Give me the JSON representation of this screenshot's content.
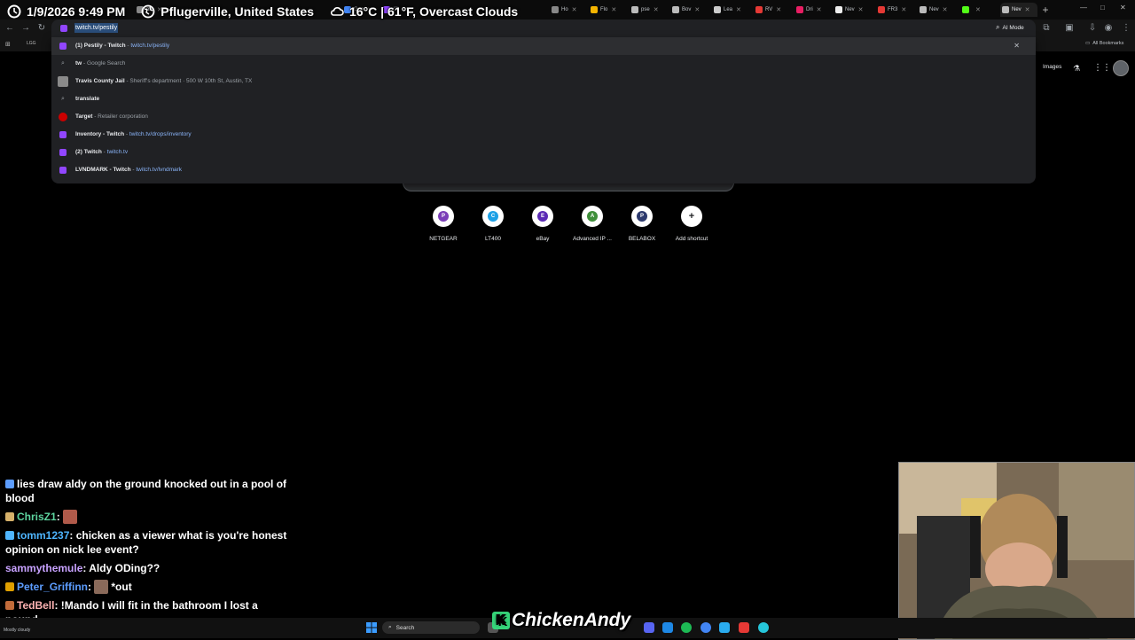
{
  "overlay": {
    "datetime": "1/9/2026 9:49 PM",
    "location": "Pflugerville, United States",
    "weather": "16°C | 61°F, Overcast Clouds"
  },
  "browser": {
    "tabs": [
      {
        "label": "nio",
        "color": "#888888"
      },
      {
        "label": "(2)",
        "color": "#9146ff"
      },
      {
        "label": "Goo",
        "color": "#4285f4"
      },
      {
        "label": "Ho",
        "color": "#888888"
      },
      {
        "label": "Flo",
        "color": "#f4b400"
      },
      {
        "label": "pse",
        "color": "#bbbbbb"
      },
      {
        "label": "Bov",
        "color": "#bbbbbb"
      },
      {
        "label": "Lea",
        "color": "#cccccc"
      },
      {
        "label": "RV",
        "color": "#e53935"
      },
      {
        "label": "Dri",
        "color": "#e91e63"
      },
      {
        "label": "Nev",
        "color": "#eeeeee"
      },
      {
        "label": "FR3",
        "color": "#e53935"
      },
      {
        "label": "Nev",
        "color": "#bbbbbb"
      },
      {
        "label": "",
        "color": "#53fc18"
      },
      {
        "label": "Nev",
        "color": "#bbbbbb",
        "active": true
      }
    ],
    "omnibox_value": "twitch.tv/pestily",
    "ai_mode_label": "AI Mode",
    "all_bookmarks_label": "All Bookmarks",
    "bookmark_partial": "LGG"
  },
  "suggestions": [
    {
      "title": "(1) Pestily - Twitch",
      "sep": " - ",
      "url": "twitch.tv/pestily",
      "desc": "",
      "icon": "twitch-icon",
      "selected": true
    },
    {
      "title": "tw",
      "sep": " - ",
      "url": "",
      "desc": "Google Search",
      "icon": "search-icon"
    },
    {
      "title": "Travis County Jail",
      "sep": " - ",
      "url": "",
      "desc": "Sheriff's department · 500 W 10th St, Austin, TX",
      "icon": "place-thumbnail-icon"
    },
    {
      "title": "translate",
      "sep": "",
      "url": "",
      "desc": "",
      "icon": "search-icon"
    },
    {
      "title": "Target",
      "sep": " - ",
      "url": "",
      "desc": "Retailer corporation",
      "icon": "target-logo-icon"
    },
    {
      "title": "Inventory - Twitch",
      "sep": " - ",
      "url": "twitch.tv/drops/inventory",
      "desc": "",
      "icon": "twitch-icon"
    },
    {
      "title": "(2) Twitch",
      "sep": " - ",
      "url": "twitch.tv",
      "desc": "",
      "icon": "twitch-icon"
    },
    {
      "title": "LVNDMARK - Twitch",
      "sep": " - ",
      "url": "twitch.tv/lvndmark",
      "desc": "",
      "icon": "twitch-icon"
    }
  ],
  "google": {
    "images_label": "Images"
  },
  "shortcuts": [
    {
      "label": "NETGEAR",
      "initial": "P",
      "color": "#7b3fb8"
    },
    {
      "label": "LT400",
      "initial": "C",
      "color": "#1ea1e6"
    },
    {
      "label": "eBay",
      "initial": "E",
      "color": "#5b2bb5"
    },
    {
      "label": "Advanced IP ...",
      "initial": "A",
      "color": "#3f8f3a"
    },
    {
      "label": "BELABOX",
      "initial": "P",
      "color": "#2d3a6e"
    },
    {
      "label": "Add shortcut",
      "initial": "+",
      "color": "#ffffff"
    }
  ],
  "chat": [
    {
      "user": "",
      "user_color": "#5c9dff",
      "message": "lies draw aldy on the ground knocked out in a pool of blood"
    },
    {
      "user": "ChrisZ1",
      "user_color": "#5dd39e",
      "message": ""
    },
    {
      "user": "tomm1237",
      "user_color": "#4fb6ff",
      "message": "chicken as a viewer what is you're honest opinion on nick lee event?"
    },
    {
      "user": "sammythemule",
      "user_color": "#c8a2ff",
      "message": "Aldy ODing??"
    },
    {
      "user": "Peter_Griffinn",
      "user_color": "#5c9dff",
      "message": "*out"
    },
    {
      "user": "TedBell",
      "user_color": "#ffb3b3",
      "message": "!Mando I will fit in the bathroom I lost a pound"
    }
  ],
  "taskbar": {
    "search_label": "Search",
    "weather_text": "Mostly cloudy"
  },
  "streamer_name": "ChickenAndy",
  "streamer_logo": "K"
}
